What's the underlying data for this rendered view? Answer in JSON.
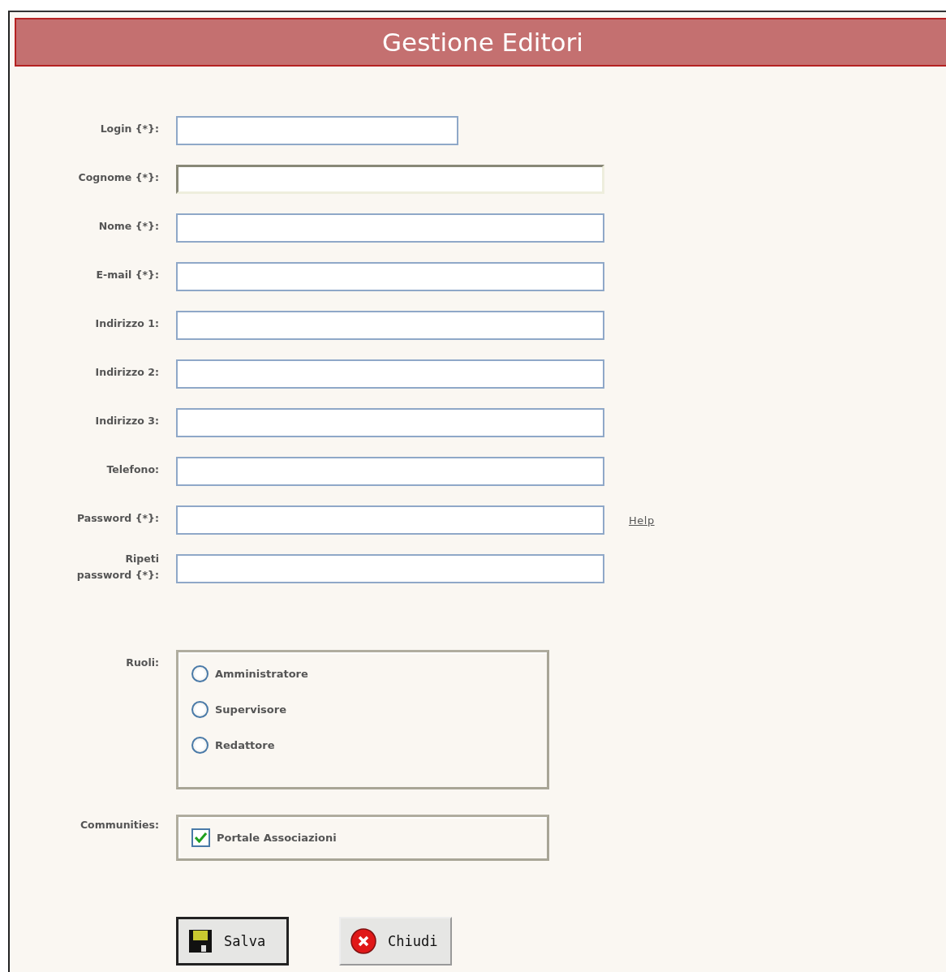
{
  "title": "Gestione Editori",
  "fields": [
    {
      "label": "Login {*}:",
      "kind": "short",
      "focused": false
    },
    {
      "label": "Cognome {*}:",
      "kind": "long",
      "focused": true
    },
    {
      "label": "Nome {*}:",
      "kind": "long",
      "focused": false
    },
    {
      "label": "E-mail {*}:",
      "kind": "long",
      "focused": false
    },
    {
      "label": "Indirizzo 1:",
      "kind": "long",
      "focused": false
    },
    {
      "label": "Indirizzo 2:",
      "kind": "long",
      "focused": false
    },
    {
      "label": "Indirizzo 3:",
      "kind": "long",
      "focused": false
    },
    {
      "label": "Telefono:",
      "kind": "long",
      "focused": false
    },
    {
      "label": "Password {*}:",
      "kind": "long",
      "focused": false,
      "link": "Help"
    },
    {
      "label": "Ripeti password {*}:",
      "kind": "long",
      "focused": false
    }
  ],
  "roles": {
    "label": "Ruoli:",
    "options": [
      {
        "label": "Amministratore",
        "selected": false
      },
      {
        "label": "Supervisore",
        "selected": false
      },
      {
        "label": "Redattore",
        "selected": false
      }
    ]
  },
  "communities": {
    "label": "Communities:",
    "options": [
      {
        "label": "Portale Associazioni",
        "checked": true
      }
    ]
  },
  "buttons": [
    {
      "label": "Salva",
      "kind": "save"
    },
    {
      "label": "Chiudi",
      "kind": "close"
    }
  ]
}
